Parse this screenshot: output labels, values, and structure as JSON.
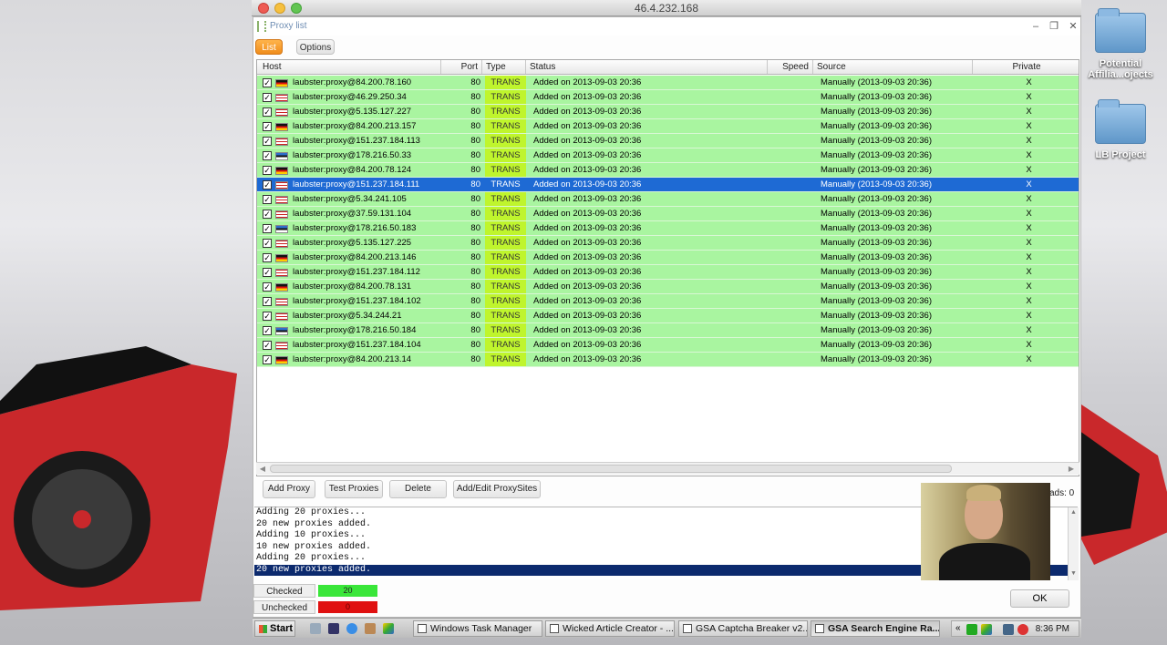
{
  "mac_window": {
    "title": "46.4.232.168"
  },
  "desktop": {
    "icons": [
      {
        "label": "Potential Affilia...ojects"
      },
      {
        "label": "LB Project"
      }
    ]
  },
  "app": {
    "title": "Proxy list",
    "tabs": [
      {
        "label": "List",
        "active": true
      },
      {
        "label": "Options",
        "active": false
      }
    ],
    "columns": [
      "Host",
      "Port",
      "Type",
      "Status",
      "Speed",
      "Source",
      "Private"
    ],
    "rows": [
      {
        "host": "laubster:proxy@84.200.78.160",
        "flag": "de",
        "port": "80",
        "type": "TRANS",
        "status": "Added on 2013-09-03 20:36",
        "speed": "",
        "source": "Manually (2013-09-03 20:36)",
        "private": "X",
        "selected": false
      },
      {
        "host": "laubster:proxy@46.29.250.34",
        "flag": "gb",
        "port": "80",
        "type": "TRANS",
        "status": "Added on 2013-09-03 20:36",
        "speed": "",
        "source": "Manually (2013-09-03 20:36)",
        "private": "X",
        "selected": false
      },
      {
        "host": "laubster:proxy@5.135.127.227",
        "flag": "gb",
        "port": "80",
        "type": "TRANS",
        "status": "Added on 2013-09-03 20:36",
        "speed": "",
        "source": "Manually (2013-09-03 20:36)",
        "private": "X",
        "selected": false
      },
      {
        "host": "laubster:proxy@84.200.213.157",
        "flag": "de",
        "port": "80",
        "type": "TRANS",
        "status": "Added on 2013-09-03 20:36",
        "speed": "",
        "source": "Manually (2013-09-03 20:36)",
        "private": "X",
        "selected": false
      },
      {
        "host": "laubster:proxy@151.237.184.113",
        "flag": "gb",
        "port": "80",
        "type": "TRANS",
        "status": "Added on 2013-09-03 20:36",
        "speed": "",
        "source": "Manually (2013-09-03 20:36)",
        "private": "X",
        "selected": false
      },
      {
        "host": "laubster:proxy@178.216.50.33",
        "flag": "ee",
        "port": "80",
        "type": "TRANS",
        "status": "Added on 2013-09-03 20:36",
        "speed": "",
        "source": "Manually (2013-09-03 20:36)",
        "private": "X",
        "selected": false
      },
      {
        "host": "laubster:proxy@84.200.78.124",
        "flag": "de",
        "port": "80",
        "type": "TRANS",
        "status": "Added on 2013-09-03 20:36",
        "speed": "",
        "source": "Manually (2013-09-03 20:36)",
        "private": "X",
        "selected": false
      },
      {
        "host": "laubster:proxy@151.237.184.111",
        "flag": "gb",
        "port": "80",
        "type": "TRANS",
        "status": "Added on 2013-09-03 20:36",
        "speed": "",
        "source": "Manually (2013-09-03 20:36)",
        "private": "X",
        "selected": true
      },
      {
        "host": "laubster:proxy@5.34.241.105",
        "flag": "gb",
        "port": "80",
        "type": "TRANS",
        "status": "Added on 2013-09-03 20:36",
        "speed": "",
        "source": "Manually (2013-09-03 20:36)",
        "private": "X",
        "selected": false
      },
      {
        "host": "laubster:proxy@37.59.131.104",
        "flag": "gb",
        "port": "80",
        "type": "TRANS",
        "status": "Added on 2013-09-03 20:36",
        "speed": "",
        "source": "Manually (2013-09-03 20:36)",
        "private": "X",
        "selected": false
      },
      {
        "host": "laubster:proxy@178.216.50.183",
        "flag": "ee",
        "port": "80",
        "type": "TRANS",
        "status": "Added on 2013-09-03 20:36",
        "speed": "",
        "source": "Manually (2013-09-03 20:36)",
        "private": "X",
        "selected": false
      },
      {
        "host": "laubster:proxy@5.135.127.225",
        "flag": "gb",
        "port": "80",
        "type": "TRANS",
        "status": "Added on 2013-09-03 20:36",
        "speed": "",
        "source": "Manually (2013-09-03 20:36)",
        "private": "X",
        "selected": false
      },
      {
        "host": "laubster:proxy@84.200.213.146",
        "flag": "de",
        "port": "80",
        "type": "TRANS",
        "status": "Added on 2013-09-03 20:36",
        "speed": "",
        "source": "Manually (2013-09-03 20:36)",
        "private": "X",
        "selected": false
      },
      {
        "host": "laubster:proxy@151.237.184.112",
        "flag": "gb",
        "port": "80",
        "type": "TRANS",
        "status": "Added on 2013-09-03 20:36",
        "speed": "",
        "source": "Manually (2013-09-03 20:36)",
        "private": "X",
        "selected": false
      },
      {
        "host": "laubster:proxy@84.200.78.131",
        "flag": "de",
        "port": "80",
        "type": "TRANS",
        "status": "Added on 2013-09-03 20:36",
        "speed": "",
        "source": "Manually (2013-09-03 20:36)",
        "private": "X",
        "selected": false
      },
      {
        "host": "laubster:proxy@151.237.184.102",
        "flag": "gb",
        "port": "80",
        "type": "TRANS",
        "status": "Added on 2013-09-03 20:36",
        "speed": "",
        "source": "Manually (2013-09-03 20:36)",
        "private": "X",
        "selected": false
      },
      {
        "host": "laubster:proxy@5.34.244.21",
        "flag": "gb",
        "port": "80",
        "type": "TRANS",
        "status": "Added on 2013-09-03 20:36",
        "speed": "",
        "source": "Manually (2013-09-03 20:36)",
        "private": "X",
        "selected": false
      },
      {
        "host": "laubster:proxy@178.216.50.184",
        "flag": "ee",
        "port": "80",
        "type": "TRANS",
        "status": "Added on 2013-09-03 20:36",
        "speed": "",
        "source": "Manually (2013-09-03 20:36)",
        "private": "X",
        "selected": false
      },
      {
        "host": "laubster:proxy@151.237.184.104",
        "flag": "gb",
        "port": "80",
        "type": "TRANS",
        "status": "Added on 2013-09-03 20:36",
        "speed": "",
        "source": "Manually (2013-09-03 20:36)",
        "private": "X",
        "selected": false
      },
      {
        "host": "laubster:proxy@84.200.213.14",
        "flag": "de",
        "port": "80",
        "type": "TRANS",
        "status": "Added on 2013-09-03 20:36",
        "speed": "",
        "source": "Manually (2013-09-03 20:36)",
        "private": "X",
        "selected": false
      }
    ],
    "buttons": {
      "add_proxy": "Add Proxy",
      "test_proxies": "Test Proxies",
      "delete": "Delete",
      "add_edit_proxysites": "Add/Edit ProxySites",
      "ok": "OK"
    },
    "threads_text": "ads: 0",
    "log": [
      {
        "text": "Adding 20 proxies...",
        "selected": false
      },
      {
        "text": "20 new proxies added.",
        "selected": false
      },
      {
        "text": "Adding 10 proxies...",
        "selected": false
      },
      {
        "text": "10 new proxies added.",
        "selected": false
      },
      {
        "text": "Adding 20 proxies...",
        "selected": false
      },
      {
        "text": "20 new proxies added.",
        "selected": true
      }
    ],
    "counters": {
      "checked_label": "Checked",
      "checked_value": "20",
      "unchecked_label": "Unchecked",
      "unchecked_value": "0"
    }
  },
  "taskbar": {
    "start": "Start",
    "items": [
      {
        "label": "Windows Task Manager",
        "active": false
      },
      {
        "label": "Wicked Article Creator - ...",
        "active": false
      },
      {
        "label": "GSA Captcha Breaker v2....",
        "active": false
      },
      {
        "label": "GSA Search Engine Ra...",
        "active": true
      }
    ],
    "clock": "8:36 PM"
  },
  "colors": {
    "row_bg": "#a9f5a0",
    "type_bg": "#bff52d",
    "selected_bg": "#1e6ad4",
    "checked_bg": "#39e639",
    "unchecked_bg": "#e01111",
    "active_tab": "#f39422"
  }
}
